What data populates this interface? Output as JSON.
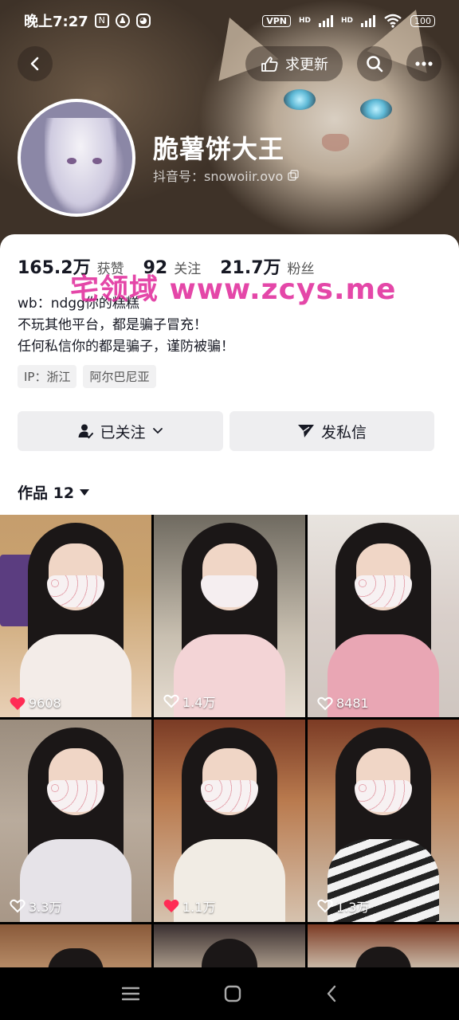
{
  "status_bar": {
    "time": "晚上7:27",
    "vpn": "VPN",
    "hd1": "HD",
    "hd2": "HD",
    "battery": "100"
  },
  "header": {
    "request_update_label": "求更新",
    "nickname": "脆薯饼大王",
    "douyin_id": "抖音号：snowoiir.ovo"
  },
  "stats": [
    {
      "num": "165.2万",
      "label": "获赞"
    },
    {
      "num": "92",
      "label": "关注"
    },
    {
      "num": "21.7万",
      "label": "粉丝"
    }
  ],
  "bio": [
    "wb：ndgg你的糕糕",
    "不玩其他平台，都是骗子冒充！",
    "任何私信你的都是骗子，谨防被骗！"
  ],
  "tags": [
    "IP：浙江",
    "阿尔巴尼亚"
  ],
  "actions": {
    "followed_label": "已关注",
    "message_label": "发私信"
  },
  "works_tab": {
    "label": "作品 12"
  },
  "watermark": "宅领域 www.zcys.me",
  "videos": [
    {
      "likes": "9608",
      "liked": true
    },
    {
      "likes": "1.4万",
      "liked": false
    },
    {
      "likes": "8481",
      "liked": false
    },
    {
      "likes": "3.3万",
      "liked": false
    },
    {
      "likes": "1.1万",
      "liked": true
    },
    {
      "likes": "1.3万",
      "liked": false
    },
    {
      "likes": "",
      "liked": false
    },
    {
      "likes": "",
      "liked": false
    },
    {
      "likes": "",
      "liked": false
    }
  ],
  "colors": {
    "like_red": "#ff2c55",
    "watermark": "#e0289a"
  }
}
